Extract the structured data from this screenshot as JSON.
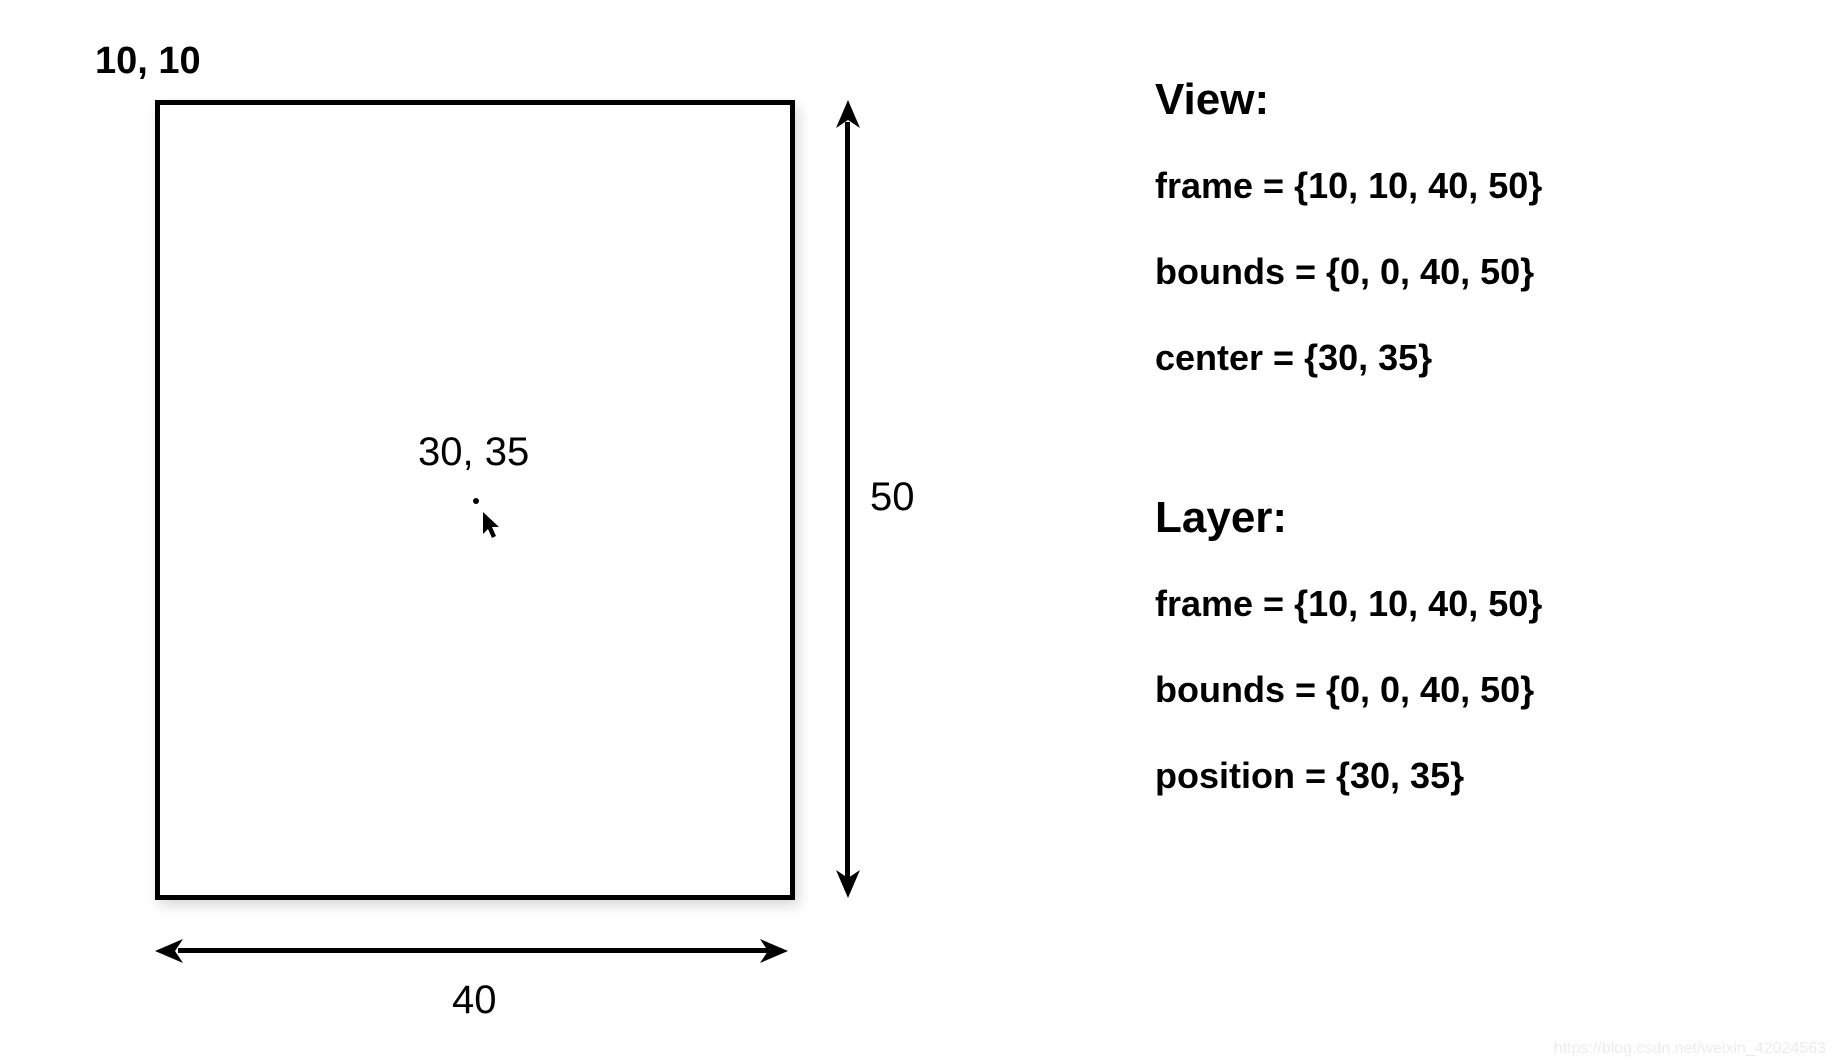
{
  "diagram": {
    "origin_label": "10, 10",
    "center_label": "30, 35",
    "width_label": "40",
    "height_label": "50"
  },
  "view": {
    "heading": "View:",
    "frame": "frame = {10, 10, 40, 50}",
    "bounds": "bounds = {0, 0, 40, 50}",
    "center": "center = {30, 35}"
  },
  "layer": {
    "heading": "Layer:",
    "frame": "frame = {10, 10, 40, 50}",
    "bounds": "bounds = {0, 0, 40, 50}",
    "position": "position = {30, 35}"
  },
  "watermark": "https://blog.csdn.net/weixin_42024563"
}
